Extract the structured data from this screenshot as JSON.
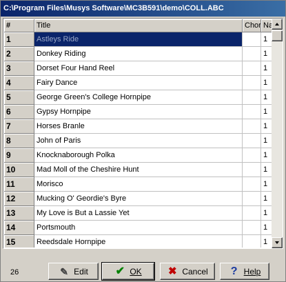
{
  "window": {
    "title": "C:\\Program Files\\Musys Software\\MC3B591\\demo\\COLL.ABC"
  },
  "grid": {
    "columns": {
      "num": "#",
      "title": "Title",
      "chord": "Chord",
      "na": "Na"
    },
    "rows": [
      {
        "num": "1",
        "title": "Astleys Ride",
        "chord": "",
        "na": "1",
        "selected": true
      },
      {
        "num": "2",
        "title": "Donkey Riding",
        "chord": "",
        "na": "1"
      },
      {
        "num": "3",
        "title": "Dorset Four Hand Reel",
        "chord": "",
        "na": "1"
      },
      {
        "num": "4",
        "title": "Fairy Dance",
        "chord": "",
        "na": "1"
      },
      {
        "num": "5",
        "title": "George Green's College Hornpipe",
        "chord": "",
        "na": "1"
      },
      {
        "num": "6",
        "title": "Gypsy Hornpipe",
        "chord": "",
        "na": "1"
      },
      {
        "num": "7",
        "title": "Horses Branle",
        "chord": "",
        "na": "1"
      },
      {
        "num": "8",
        "title": "John of Paris",
        "chord": "",
        "na": "1"
      },
      {
        "num": "9",
        "title": "Knocknaborough Polka",
        "chord": "",
        "na": "1"
      },
      {
        "num": "10",
        "title": "Mad Moll of the Cheshire Hunt",
        "chord": "",
        "na": "1"
      },
      {
        "num": "11",
        "title": "Morisco",
        "chord": "",
        "na": "1"
      },
      {
        "num": "12",
        "title": "Mucking O' Geordie's Byre",
        "chord": "",
        "na": "1"
      },
      {
        "num": "13",
        "title": "My Love is But a Lassie Yet",
        "chord": "",
        "na": "1"
      },
      {
        "num": "14",
        "title": "Portsmouth",
        "chord": "",
        "na": "1"
      },
      {
        "num": "15",
        "title": "Reedsdale Hornpipe",
        "chord": "",
        "na": "1"
      }
    ]
  },
  "footer": {
    "count": "26",
    "edit_label": "Edit",
    "ok_label": "OK",
    "cancel_label": "Cancel",
    "help_label": "Help"
  },
  "icons": {
    "edit": "pencil-icon",
    "ok": "checkmark-icon",
    "cancel": "cross-icon",
    "help": "question-mark-icon"
  },
  "colors": {
    "titlebar_start": "#0a246a",
    "titlebar_end": "#3a6ea5",
    "selection": "#0a246a",
    "face": "#d4d0c8"
  }
}
